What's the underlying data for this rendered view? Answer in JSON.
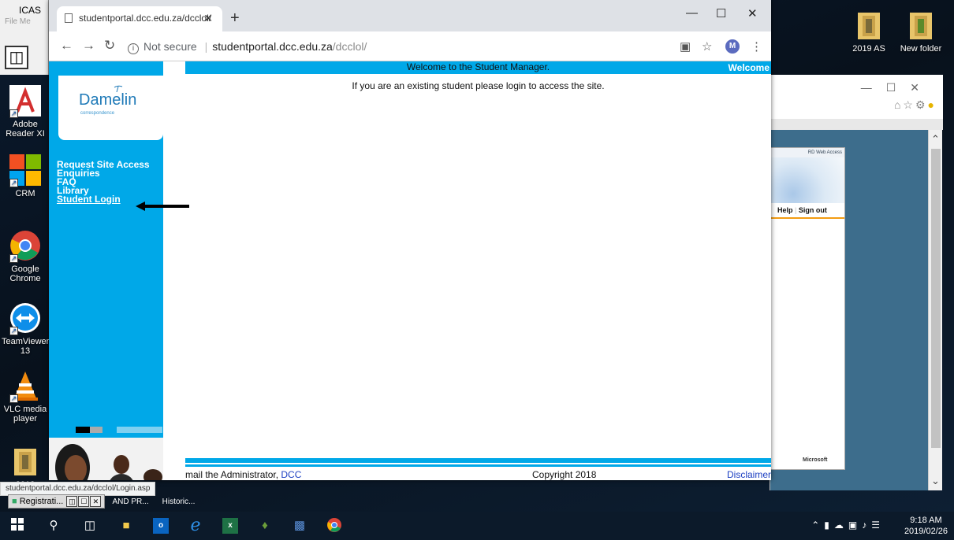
{
  "desktop": {
    "icons": [
      {
        "label": "Adobe Reader XI"
      },
      {
        "label": "CRM"
      },
      {
        "label": "Google Chrome"
      },
      {
        "label": "TeamViewer 13"
      },
      {
        "label": "VLC media player"
      },
      {
        "label": "2018"
      },
      {
        "label": "2019 AS"
      },
      {
        "label": "New folder"
      }
    ],
    "icas_title": "ICAS",
    "icas_menu": "File  Me"
  },
  "browser": {
    "tab_title": "studentportal.dcc.edu.za/dcclol/",
    "url_prefix": "Not secure",
    "url_domain": "studentportal.dcc.edu.za",
    "url_path": "/dcclol/",
    "avatar_letter": "M",
    "status_url": "studentportal.dcc.edu.za/dcclol/Login.asp"
  },
  "page": {
    "topbar_welcome": "Welcome",
    "logo_brand": "Damelin",
    "logo_sub": "correspondence",
    "menu": [
      {
        "label": "Request Site Access"
      },
      {
        "label": "Enquiries"
      },
      {
        "label": "FAQ"
      },
      {
        "label": "Library"
      },
      {
        "label": "Student Login"
      }
    ],
    "welcome_heading": "Welcome to the Student Manager.",
    "welcome_text": "If you are an existing student please login to access the site.",
    "footer_admin_prefix": "mail the Administrator, ",
    "footer_admin_link": "DCC",
    "footer_copyright": "Copyright 2018",
    "footer_disclaimer": "Disclaimer"
  },
  "background_window": {
    "rd_label": "RD Web Access",
    "help": "Help",
    "signout": "Sign out",
    "brand": "Microsoft"
  },
  "minimized": {
    "label": "Registrati...",
    "item1": "AND PR...",
    "item2": "Historic..."
  },
  "taskbar": {
    "time": "9:18 AM",
    "date": "2019/02/26"
  },
  "colors": {
    "accent": "#00a8e8",
    "link": "#1c3fc2"
  }
}
